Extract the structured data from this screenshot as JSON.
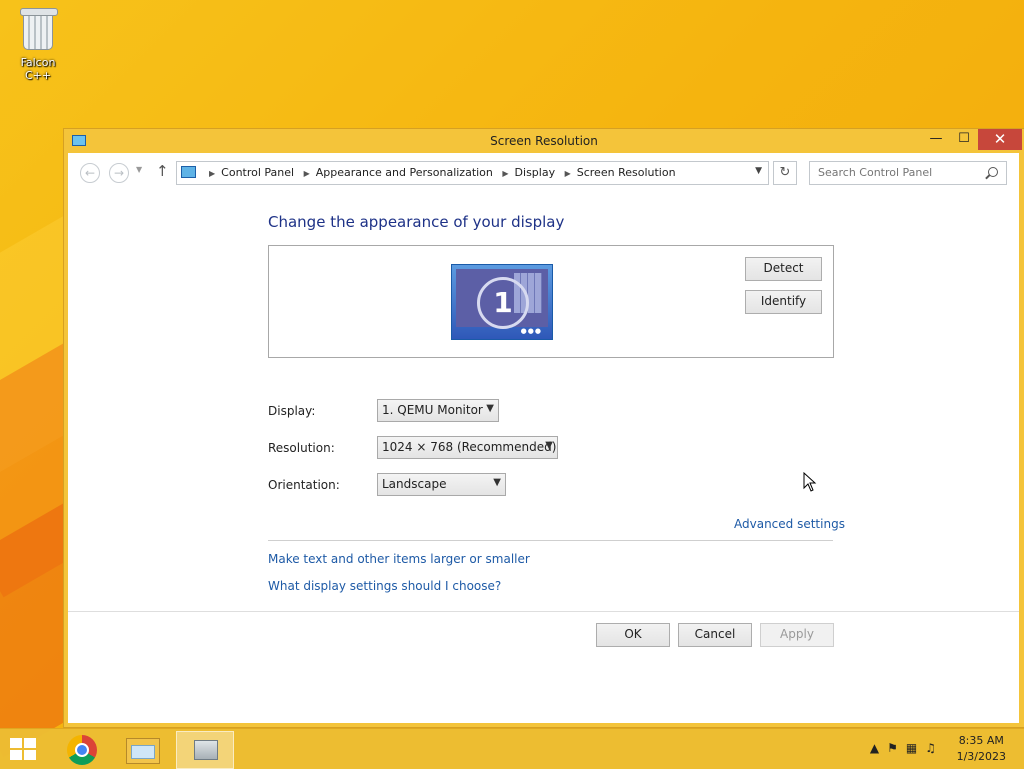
{
  "desktop": {
    "icon_label": "Falcon C++"
  },
  "window": {
    "title": "Screen Resolution",
    "controls": {
      "minimize": "—",
      "maximize": "☐",
      "close": "✕"
    }
  },
  "address_bar": {
    "crumbs": [
      "Control Panel",
      "Appearance and Personalization",
      "Display",
      "Screen Resolution"
    ],
    "search_placeholder": "Search Control Panel"
  },
  "main": {
    "heading": "Change the appearance of your display",
    "monitor_number": "1",
    "detect_label": "Detect",
    "identify_label": "Identify",
    "display_label": "Display:",
    "display_value": "1. QEMU Monitor",
    "resolution_label": "Resolution:",
    "resolution_value": "1024 × 768 (Recommended)",
    "orientation_label": "Orientation:",
    "orientation_value": "Landscape",
    "advanced_link": "Advanced settings",
    "link_text_size": "Make text and other items larger or smaller",
    "link_display_help": "What display settings should I choose?"
  },
  "footer": {
    "ok": "OK",
    "cancel": "Cancel",
    "apply": "Apply"
  },
  "taskbar": {
    "time": "8:35 AM",
    "date": "1/3/2023"
  },
  "icons": [
    "recycle-bin-icon",
    "screen-resolution-icon",
    "monitor-icon",
    "search-icon",
    "refresh-icon",
    "chrome-icon",
    "file-explorer-icon",
    "control-panel-icon",
    "windows-start-icon",
    "flag-icon",
    "network-icon",
    "speaker-icon"
  ]
}
